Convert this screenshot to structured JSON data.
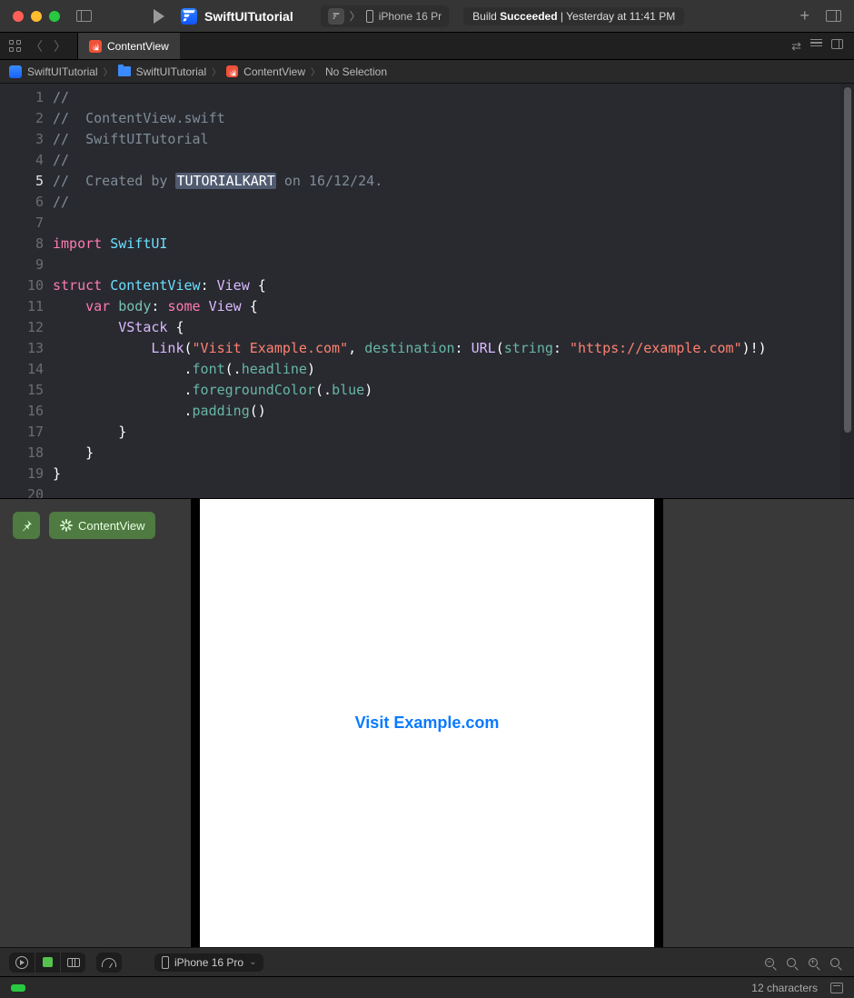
{
  "titlebar": {
    "projectName": "SwiftUITutorial",
    "scheme": {
      "deviceLabel": "iPhone 16 Pr"
    },
    "status": {
      "prefix": "Build ",
      "bold": "Succeeded",
      "suffix": " | Yesterday at 11:41 PM"
    }
  },
  "tab": {
    "filename": "ContentView"
  },
  "breadcrumb": {
    "items": [
      "SwiftUITutorial",
      "SwiftUITutorial",
      "ContentView",
      "No Selection"
    ]
  },
  "code": {
    "lines": [
      {
        "n": 1,
        "seg": [
          [
            "cm",
            "//"
          ]
        ]
      },
      {
        "n": 2,
        "seg": [
          [
            "cm",
            "//  ContentView.swift"
          ]
        ]
      },
      {
        "n": 3,
        "seg": [
          [
            "cm",
            "//  SwiftUITutorial"
          ]
        ]
      },
      {
        "n": 4,
        "seg": [
          [
            "cm",
            "//"
          ]
        ]
      },
      {
        "n": 5,
        "cur": true,
        "seg": [
          [
            "cm",
            "//  Created by "
          ],
          [
            "sel",
            "TUTORIALKART"
          ],
          [
            "cm",
            " on 16/12/24."
          ]
        ]
      },
      {
        "n": 6,
        "seg": [
          [
            "cm",
            "//"
          ]
        ]
      },
      {
        "n": 7,
        "seg": []
      },
      {
        "n": 8,
        "seg": [
          [
            "kw",
            "import"
          ],
          [
            "pl",
            " "
          ],
          [
            "tyb",
            "SwiftUI"
          ]
        ]
      },
      {
        "n": 9,
        "seg": []
      },
      {
        "n": 10,
        "seg": [
          [
            "kw",
            "struct"
          ],
          [
            "pl",
            " "
          ],
          [
            "tyb",
            "ContentView"
          ],
          [
            "pl",
            ": "
          ],
          [
            "ty",
            "View"
          ],
          [
            "pl",
            " {"
          ]
        ]
      },
      {
        "n": 11,
        "seg": [
          [
            "pl",
            "    "
          ],
          [
            "kw",
            "var"
          ],
          [
            "pl",
            " "
          ],
          [
            "var",
            "body"
          ],
          [
            "pl",
            ": "
          ],
          [
            "kw",
            "some"
          ],
          [
            "pl",
            " "
          ],
          [
            "ty",
            "View"
          ],
          [
            "pl",
            " {"
          ]
        ]
      },
      {
        "n": 12,
        "seg": [
          [
            "pl",
            "        "
          ],
          [
            "ty",
            "VStack"
          ],
          [
            "pl",
            " {"
          ]
        ]
      },
      {
        "n": 13,
        "seg": [
          [
            "pl",
            "            "
          ],
          [
            "ty",
            "Link"
          ],
          [
            "pl",
            "("
          ],
          [
            "str",
            "\"Visit Example.com\""
          ],
          [
            "pl",
            ", "
          ],
          [
            "fn",
            "destination"
          ],
          [
            "pl",
            ": "
          ],
          [
            "ty",
            "URL"
          ],
          [
            "pl",
            "("
          ],
          [
            "fn",
            "string"
          ],
          [
            "pl",
            ": "
          ],
          [
            "str",
            "\"https://example.com\""
          ],
          [
            "pl",
            ")!)"
          ]
        ]
      },
      {
        "n": 14,
        "seg": [
          [
            "pl",
            "                ."
          ],
          [
            "fn",
            "font"
          ],
          [
            "pl",
            "(."
          ],
          [
            "fn",
            "headline"
          ],
          [
            "pl",
            ")"
          ]
        ]
      },
      {
        "n": 15,
        "seg": [
          [
            "pl",
            "                ."
          ],
          [
            "fn",
            "foregroundColor"
          ],
          [
            "pl",
            "(."
          ],
          [
            "fn",
            "blue"
          ],
          [
            "pl",
            ")"
          ]
        ]
      },
      {
        "n": 16,
        "seg": [
          [
            "pl",
            "                ."
          ],
          [
            "fn",
            "padding"
          ],
          [
            "pl",
            "()"
          ]
        ]
      },
      {
        "n": 17,
        "seg": [
          [
            "pl",
            "        }"
          ]
        ]
      },
      {
        "n": 18,
        "seg": [
          [
            "pl",
            "    }"
          ]
        ]
      },
      {
        "n": 19,
        "seg": [
          [
            "pl",
            "}"
          ]
        ]
      },
      {
        "n": 20,
        "seg": []
      }
    ]
  },
  "canvas": {
    "chipLabel": "ContentView",
    "previewText": "Visit Example.com",
    "deviceSelect": "iPhone 16 Pro"
  },
  "statusbar": {
    "characters": "12 characters"
  }
}
